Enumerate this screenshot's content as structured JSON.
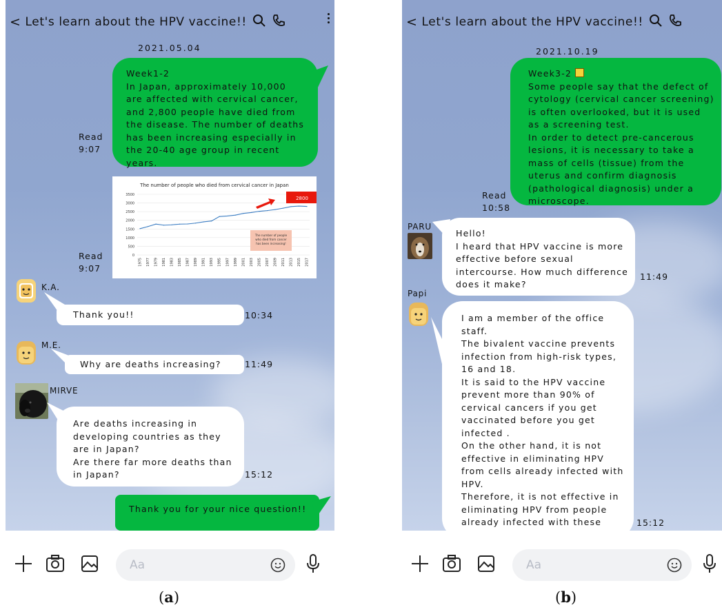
{
  "panel_a": {
    "header_title": "Let's learn about the HPV vaccine!!",
    "date": "2021.05.04",
    "msg1": {
      "text": "Week1-2\nIn Japan, approximately 10,000 are affected with cervical cancer, and 2,800 people have died from the disease. The number of deaths has been increasing especially in the 20-40 age group in recent years.",
      "status": "Read\n9:07"
    },
    "msg_image": {
      "status": "Read\n9:07",
      "chart_data": {
        "type": "line",
        "title": "The number of people who died from cervical cancer in Japan",
        "x": [
          "1975",
          "1977",
          "1979",
          "1981",
          "1983",
          "1985",
          "1987",
          "1989",
          "1991",
          "1993",
          "1995",
          "1997",
          "1999",
          "2001",
          "2003",
          "2005",
          "2007",
          "2009",
          "2011",
          "2013",
          "2015",
          "2017"
        ],
        "series": [
          {
            "values": [
              1520,
              1640,
              1780,
              1720,
              1740,
              1780,
              1790,
              1840,
              1910,
              1960,
              2220,
              2250,
              2300,
              2400,
              2450,
              2520,
              2560,
              2620,
              2700,
              2790,
              2820,
              2800
            ]
          }
        ],
        "ylim": [
          0,
          3500
        ],
        "yticks": [
          0,
          500,
          1000,
          1500,
          2000,
          2500,
          3000,
          3500
        ],
        "annotations": [
          "2800",
          "The number of people who died from cancer has been increasing!"
        ]
      }
    },
    "ka": {
      "name": "K.A.",
      "text": "Thank you!!",
      "time": "10:34"
    },
    "me": {
      "name": "M.E.",
      "text": "Why are deaths increasing?",
      "time": "11:49"
    },
    "mirve": {
      "name": "MIRVE",
      "text": "Are deaths increasing in developing countries as they are in Japan?\nAre there far more deaths than in Japan?",
      "time": "15:12"
    },
    "reply": {
      "text": "Thank you for your nice question!!"
    },
    "input_placeholder": "Aa",
    "caption_letter": "a"
  },
  "panel_b": {
    "header_title": "Let's learn about the HPV vaccine!!",
    "date": "2021.10.19",
    "msg1": {
      "title": "Week3-2",
      "text": "Some people say that the defect of cytology (cervical cancer screening) is often overlooked, but it is used as a screening test.\nIn order to detect pre-cancerous lesions, it is necessary to take a mass of cells (tissue) from the uterus and confirm diagnosis (pathological diagnosis) under a microscope.",
      "status": "Read\n10:58"
    },
    "paru": {
      "name": "PARU",
      "text": "Hello!\nI heard that HPV vaccine is more effective before sexual intercourse. How much difference does it make?",
      "time": "11:49"
    },
    "papi": {
      "name": "Papi",
      "text": "I am a member of the office staff.\nThe bivalent vaccine prevents infection from high-risk types, 16 and 18.\nIt is said to the HPV vaccine prevent more than 90% of cervical cancers if you get vaccinated before you get infected .\nOn the other hand, it is not effective in eliminating HPV from cells already infected with HPV.\nTherefore, it is not effective in eliminating HPV from people already infected with these types of HPV.",
      "time": "15:12"
    },
    "input_placeholder": "Aa",
    "caption_letter": "b"
  },
  "colors": {
    "green_bubble": "#05b740",
    "background": "#93a8d0"
  }
}
